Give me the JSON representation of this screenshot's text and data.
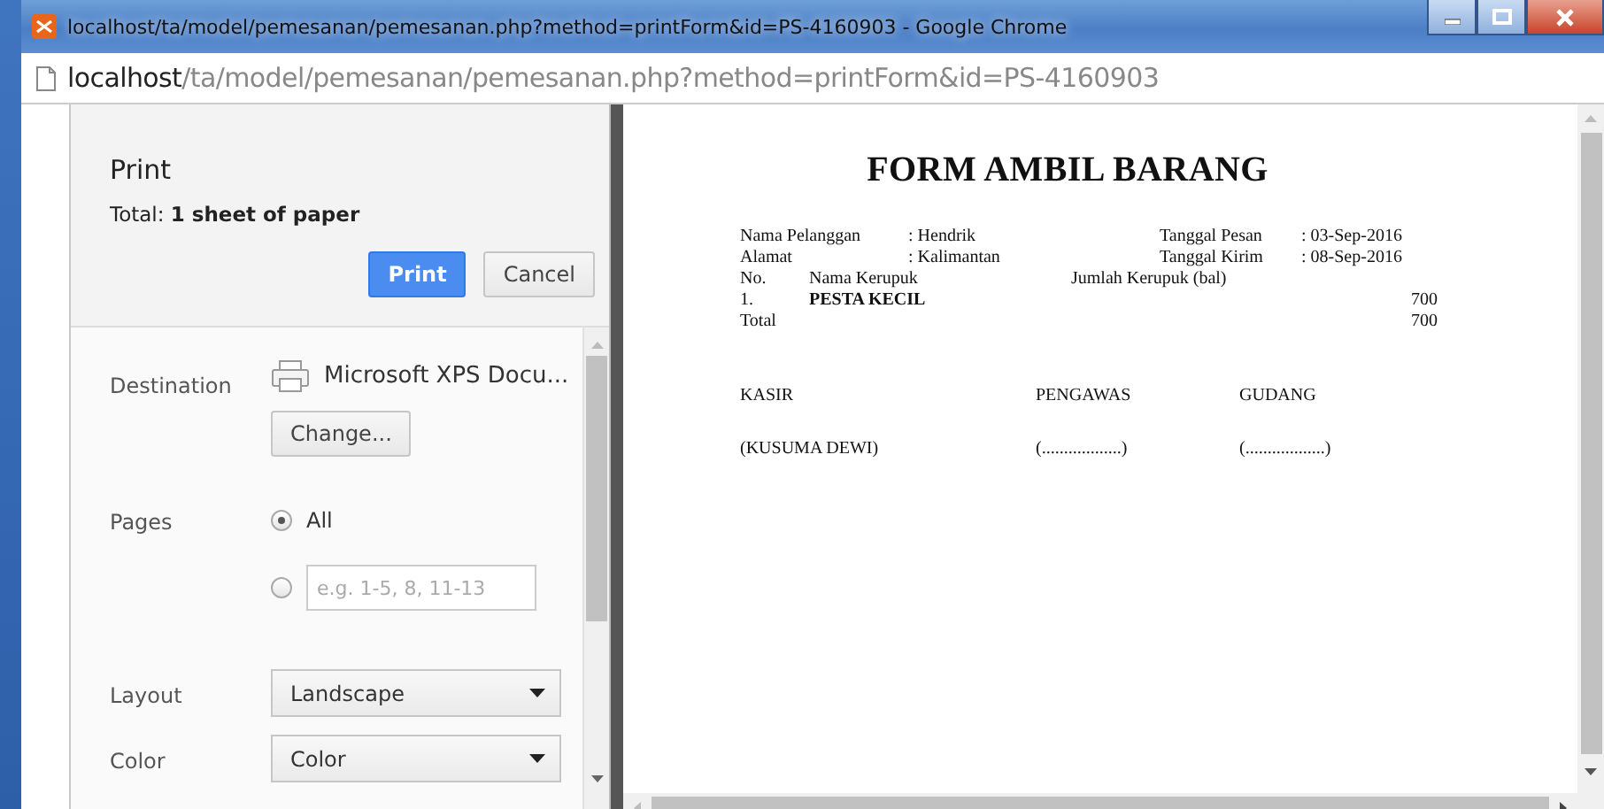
{
  "window": {
    "title": "localhost/ta/model/pemesanan/pemesanan.php?method=printForm&id=PS-4160903 - Google Chrome"
  },
  "address_bar": {
    "host": "localhost",
    "path": "/ta/model/pemesanan/pemesanan.php?method=printForm&id=PS-4160903"
  },
  "print_panel": {
    "title": "Print",
    "total": "Total: **1 sheet of paper**",
    "buttons": [
      {
        "label": "Print",
        "kind": "primary"
      },
      {
        "label": "Cancel",
        "kind": "secondary"
      }
    ],
    "settings": [
      {
        "kind": "destination",
        "label": "Destination",
        "value": "Microsoft XPS Docu...",
        "button": "Change..."
      },
      {
        "kind": "pages",
        "label": "Pages",
        "options": [
          {
            "label": "All",
            "selected": true
          },
          {
            "placeholder": "e.g. 1-5, 8, 11-13",
            "selected": false
          }
        ]
      },
      {
        "kind": "select",
        "label": "Layout",
        "value": "Landscape"
      },
      {
        "kind": "select",
        "label": "Color",
        "value": "Color"
      }
    ]
  },
  "preview": {
    "title": "FORM AMBIL BARANG",
    "info": [
      {
        "label": "Nama Pelanggan",
        "value": ": Hendrik",
        "label_2": "Tanggal Pesan",
        "value_2": ": 03-Sep-2016"
      },
      {
        "label": "Alamat",
        "value": ": Kalimantan",
        "label_2": "Tanggal Kirim",
        "value_2": ": 08-Sep-2016"
      }
    ],
    "table": {
      "columns": [
        "No.",
        "Nama Kerupuk",
        "Jumlah Kerupuk (bal)"
      ],
      "rows": [
        [
          "1.",
          "PESTA KECIL",
          "700"
        ]
      ],
      "total": {
        "label": "Total",
        "value": "700"
      }
    },
    "signatures": [
      {
        "role": "KASIR",
        "name": "(KUSUMA DEWI)"
      },
      {
        "role": "PENGAWAS",
        "name": "(..................)"
      },
      {
        "role": "GUDANG",
        "name": "(..................)"
      }
    ]
  }
}
